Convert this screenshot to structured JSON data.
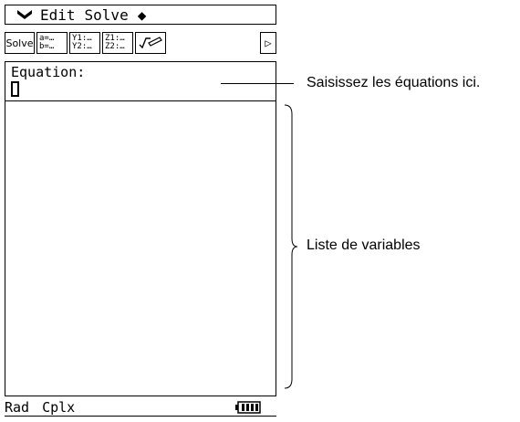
{
  "menu": {
    "chevron_icon": "chevron-down-icon",
    "items": [
      "Edit",
      "Solve"
    ],
    "diamond": "◆"
  },
  "toolbar": {
    "solve_label": "Solve",
    "button2_line1": "a=…",
    "button2_line2": "b=…",
    "button3_line1": "Y1:…",
    "button3_line2": "Y2:…",
    "button4_line1": "Z1:…",
    "button4_line2": "Z2:…",
    "button5_label": "√⁄",
    "scroll_label": "▷"
  },
  "equation": {
    "label": "Equation:"
  },
  "status": {
    "angle": "Rad",
    "mode": "Cplx"
  },
  "annotations": {
    "equation_callout": "Saisissez les équations ici.",
    "variables_callout": "Liste de variables"
  }
}
